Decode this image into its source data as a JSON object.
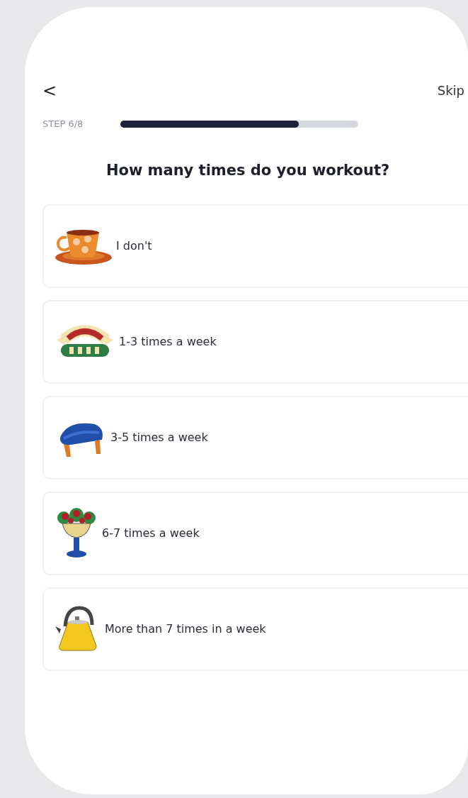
{
  "header": {
    "back": "<",
    "skip": "Skip"
  },
  "progress": {
    "label": "STEP 6/8",
    "level": 0.75
  },
  "question": "How many times do you workout?",
  "options": [
    {
      "label": "I don't",
      "kind": "cup",
      "selected": false
    },
    {
      "label": "1-3 times a week",
      "kind": "sign",
      "selected": false
    },
    {
      "label": "3-5 times a week",
      "kind": "footstool",
      "selected": false
    },
    {
      "label": "6-7 times a week",
      "kind": "vase",
      "selected": false
    },
    {
      "label": "More than 7 times in a week",
      "kind": "kettle",
      "selected": false
    }
  ]
}
